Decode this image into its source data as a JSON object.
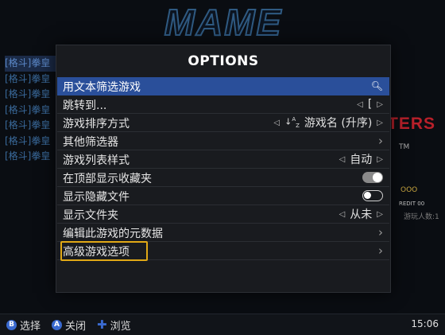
{
  "background": {
    "logo_text": "MAME",
    "game_list": [
      "[格斗]拳皇",
      "[格斗]拳皇",
      "[格斗]拳皇",
      "[格斗]拳皇",
      "[格斗]拳皇",
      "[格斗]拳皇",
      "[格斗]拳皇"
    ],
    "art_title": "TERS",
    "art_tm": "TM",
    "art_coins": "OOO",
    "art_credit": "REDIT  00",
    "player_count": "游玩人数:1"
  },
  "dialog": {
    "title": "OPTIONS",
    "items": [
      {
        "label": "用文本筛选游戏",
        "icon": "search-icon"
      },
      {
        "label": "跳转到...",
        "value": "["
      },
      {
        "label": "游戏排序方式",
        "value": "游戏名 (升序)",
        "icon": "sort-az-icon"
      },
      {
        "label": "其他筛选器"
      },
      {
        "label": "游戏列表样式",
        "value": "自动"
      },
      {
        "label": "在顶部显示收藏夹",
        "toggle": "on"
      },
      {
        "label": "显示隐藏文件",
        "toggle": "off"
      },
      {
        "label": "显示文件夹",
        "value": "从未"
      },
      {
        "label": "编辑此游戏的元数据"
      },
      {
        "label": "高级游戏选项"
      }
    ]
  },
  "footer": {
    "select_button": "B",
    "select_label": "选择",
    "close_button": "A",
    "close_label": "关闭",
    "browse_label": "浏览",
    "clock": "15:06"
  },
  "colors": {
    "accent": "#2a4f9a",
    "focus_border": "#e0a816",
    "button_blue": "#3a6ad0"
  }
}
